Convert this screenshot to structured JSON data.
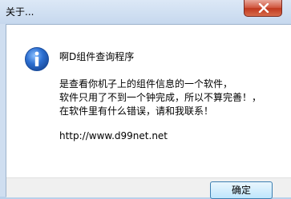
{
  "window": {
    "title": "关于...",
    "close_icon": "close-icon"
  },
  "dialog": {
    "icon": "info-icon",
    "app_name": "啊D组件查询程序",
    "description_lines": [
      "是查看你机子上的组件信息的一个软件，",
      "软件只用了不到一个钟完成，所以不算完善！，",
      "在软件里有什么错误，请和我联系！"
    ],
    "url": "http://www.d99net.net",
    "ok_label": "确定"
  },
  "colors": {
    "icon_blue": "#2c6fd1",
    "close_red": "#c0381e"
  }
}
